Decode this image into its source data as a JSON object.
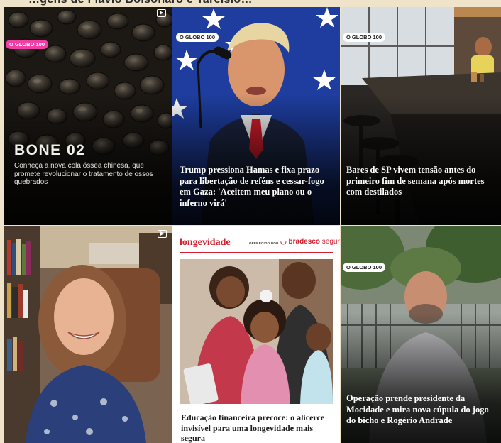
{
  "top_strip_text": "…gens de Flávio Bolsonaro e Tarcísio…",
  "tiles": [
    {
      "badge": "O GLOBO 100",
      "badge_style": "pink",
      "title": "BONE 02",
      "description": "Conheça a nova cola óssea chinesa, que promete revolucionar o tratamento de ossos quebrados",
      "icon": "video-icon"
    },
    {
      "badge": "O GLOBO 100",
      "headline": "Trump pressiona Hamas e fixa prazo para libertação de reféns e cessar-fogo em Gaza: 'Aceitem meu plano ou o inferno virá'"
    },
    {
      "badge": "O GLOBO 100",
      "headline": "Bares de SP vivem tensão antes do primeiro fim de semana após mortes com destilados"
    },
    {
      "icon": "video-icon"
    },
    {
      "brand": "longevidade",
      "offered_by": "OFERECIDO POR",
      "sponsor_bold": "bradesco",
      "sponsor_light": "seguros",
      "headline": "Educação financeira precoce: o alicerce invisível para uma longevidade mais segura"
    },
    {
      "badge": "O GLOBO 100",
      "headline": "Operação prende presidente da Mocidade e mira nova cúpula do jogo do bicho e Rogério Andrade"
    }
  ],
  "colors": {
    "page_background": "#efe4c9",
    "badge_pink": "#ef3fa4",
    "brand_red": "#d2202f",
    "flag_blue": "#1f3fa8"
  }
}
